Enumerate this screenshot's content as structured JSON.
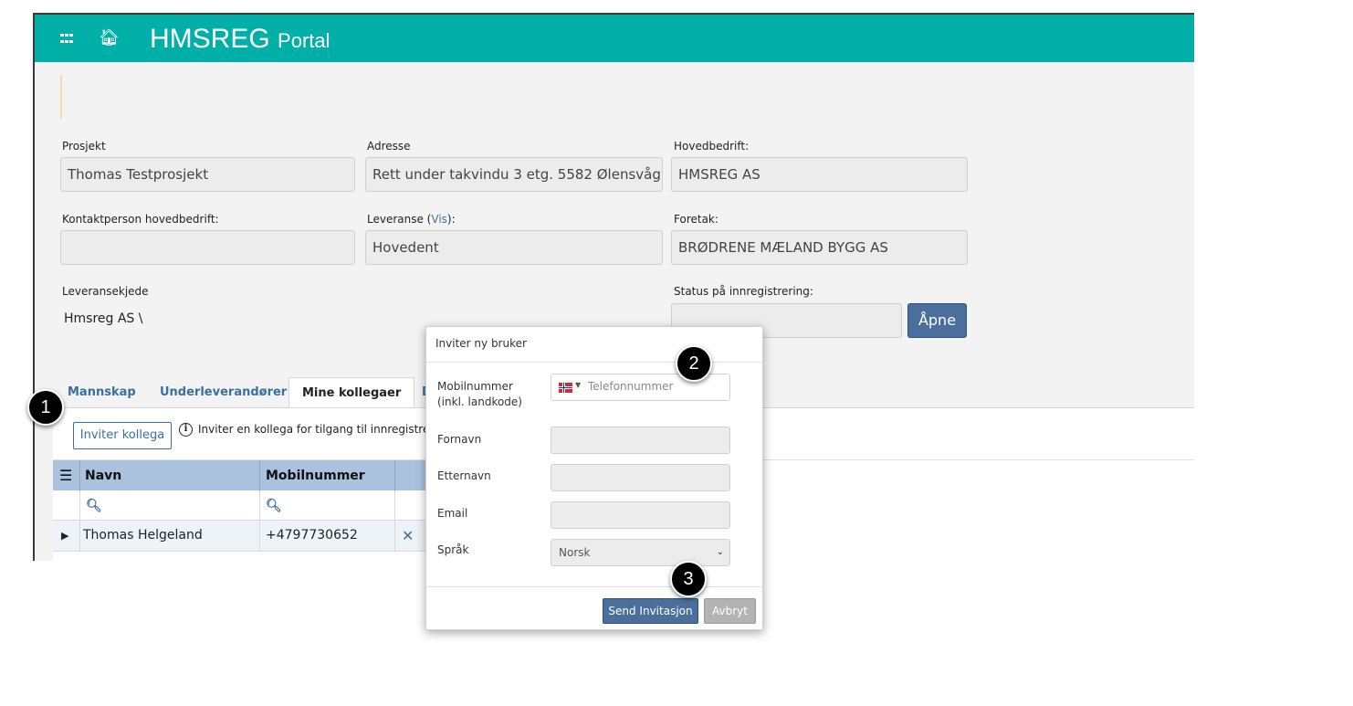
{
  "header": {
    "brand": "HMSREG",
    "brand_sub": "Portal"
  },
  "project": {
    "prosjekt_label": "Prosjekt",
    "prosjekt_value": "Thomas Testprosjekt",
    "adresse_label": "Adresse",
    "adresse_value": "Rett under takvindu 3 etg. 5582 Ølensvåg",
    "hovedbedrift_label": "Hovedbedrift:",
    "hovedbedrift_value": "HMSREG AS",
    "kontakt_label": "Kontaktperson hovedbedrift:",
    "kontakt_value": "",
    "leveranse_label_prefix": "Leveranse (",
    "leveranse_link": "Vis",
    "leveranse_label_suffix": "):",
    "leveranse_value": "Hovedent",
    "foretak_label": "Foretak:",
    "foretak_value": "BRØDRENE MÆLAND BYGG AS",
    "kjede_label": "Leveransekjede",
    "kjede_value": "Hmsreg AS \\",
    "status_label": "Status på innregistrering:",
    "status_value": "",
    "apne_label": "Åpne"
  },
  "tabs": [
    {
      "label": "Mannskap"
    },
    {
      "label": "Underleverandører"
    },
    {
      "label": "Mine kollegaer"
    },
    {
      "label": "D"
    }
  ],
  "toolbar": {
    "invite_button": "Inviter kollega",
    "info_text": "Inviter en kollega for tilgang til innregistre"
  },
  "table": {
    "columns": [
      "Navn",
      "Mobilnummer"
    ],
    "rows": [
      {
        "navn": "Thomas Helgeland",
        "mobil": "+4797730652"
      }
    ]
  },
  "modal": {
    "title": "Inviter ny bruker",
    "mobil_label_1": "Mobilnummer",
    "mobil_label_2": "(inkl. landkode)",
    "phone_placeholder": "Telefonnummer",
    "fornavn_label": "Fornavn",
    "etternavn_label": "Etternavn",
    "email_label": "Email",
    "sprak_label": "Språk",
    "sprak_value": "Norsk",
    "send_button": "Send Invitasjon",
    "cancel_button": "Avbryt"
  },
  "callouts": [
    "1",
    "2",
    "3"
  ],
  "colors": {
    "topbar": "#00b0a8",
    "primary_button": "#4a6f9c",
    "table_header": "#aac2de",
    "link": "#3a6fa2"
  },
  "icons": [
    "grid-icon",
    "home-icon",
    "info-icon",
    "search-icon",
    "expand-arrow-icon",
    "delete-icon",
    "norway-flag-icon",
    "chevron-down-icon"
  ]
}
